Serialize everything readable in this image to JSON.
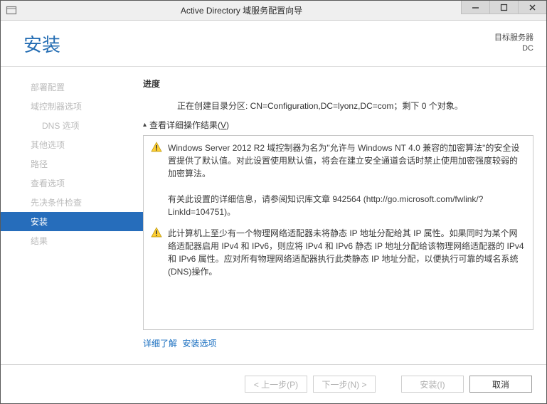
{
  "title": "Active Directory 域服务配置向导",
  "header": {
    "h1": "安装",
    "server_label": "目标服务器",
    "server_name": "DC"
  },
  "sidebar": {
    "items": [
      {
        "label": "部署配置"
      },
      {
        "label": "域控制器选项"
      },
      {
        "label": "DNS 选项"
      },
      {
        "label": "其他选项"
      },
      {
        "label": "路径"
      },
      {
        "label": "查看选项"
      },
      {
        "label": "先决条件检查"
      },
      {
        "label": "安装"
      },
      {
        "label": "结果"
      }
    ]
  },
  "main": {
    "section": "进度",
    "progress_text": "正在创建目录分区: CN=Configuration,DC=lyonz,DC=com；剩下 0 个对象。",
    "expander_prefix": "查看详细操作结果(",
    "expander_key": "V",
    "expander_suffix": ")",
    "results": [
      {
        "text": "Windows Server 2012 R2 域控制器为名为\"允许与 Windows NT 4.0 兼容的加密算法\"的安全设置提供了默认值。对此设置使用默认值，将会在建立安全通道会话时禁止使用加密强度较弱的加密算法。\n\n有关此设置的详细信息，请参阅知识库文章 942564 (http://go.microsoft.com/fwlink/?LinkId=104751)。"
      },
      {
        "text": "此计算机上至少有一个物理网络适配器未将静态 IP 地址分配给其 IP 属性。如果同时为某个网络适配器启用 IPv4 和 IPv6，则应将 IPv4 和 IPv6 静态 IP 地址分配给该物理网络适配器的 IPv4 和 IPv6 属性。应对所有物理网络适配器执行此类静态 IP 地址分配，以便执行可靠的域名系统(DNS)操作。"
      }
    ],
    "link1": "详细了解",
    "link2": "安装选项"
  },
  "footer": {
    "prev": "< 上一步(P)",
    "next": "下一步(N) >",
    "install": "安装(I)",
    "cancel": "取消"
  }
}
